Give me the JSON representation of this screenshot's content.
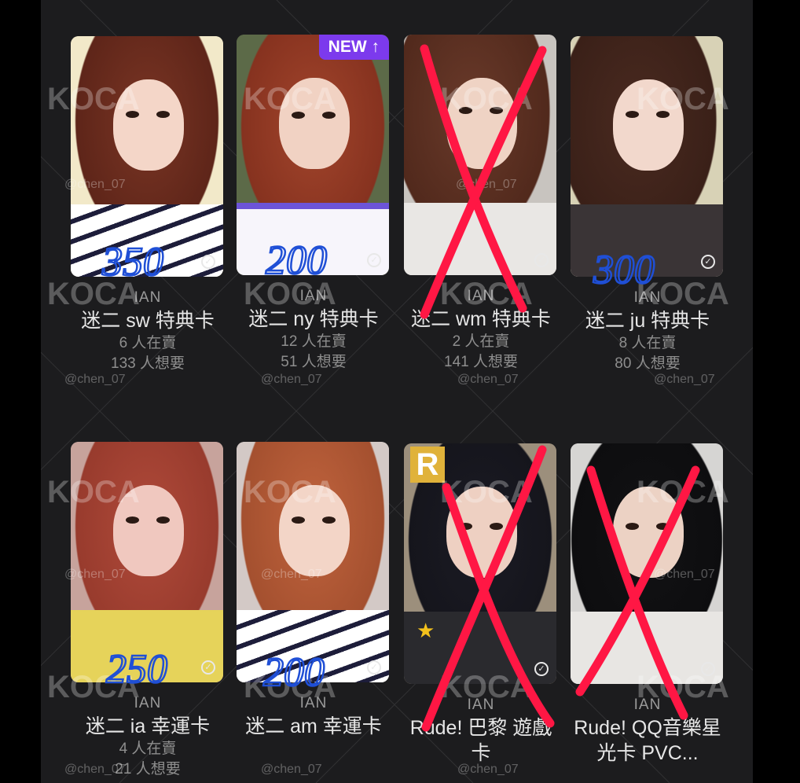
{
  "watermark": {
    "logo": "KOCA",
    "handle": "@chen_07"
  },
  "colors": {
    "panel": "#1c1c1e",
    "badge": "#7c3aed",
    "price_ink": "#1f4fd6",
    "cross_ink": "#ff1744"
  },
  "cards": [
    {
      "artist": "IAN",
      "title": "迷二 sw 特典卡",
      "selling": "6 人在賣",
      "wanting": "133 人想要",
      "price": "350",
      "crossed": false,
      "new_badge": "",
      "check_icon": "check-circle-icon"
    },
    {
      "artist": "IAN",
      "title": "迷二 ny 特典卡",
      "selling": "12 人在賣",
      "wanting": "51 人想要",
      "price": "200",
      "crossed": false,
      "new_badge": "NEW ↑",
      "check_icon": "check-circle-icon"
    },
    {
      "artist": "IAN",
      "title": "迷二 wm 特典卡",
      "selling": "2 人在賣",
      "wanting": "141 人想要",
      "price": "",
      "crossed": true,
      "new_badge": "",
      "check_icon": "check-circle-icon"
    },
    {
      "artist": "IAN",
      "title": "迷二 ju 特典卡",
      "selling": "8 人在賣",
      "wanting": "80 人想要",
      "price": "300",
      "crossed": false,
      "new_badge": "",
      "check_icon": "check-circle-icon"
    },
    {
      "artist": "IAN",
      "title": "迷二 ia 幸運卡",
      "selling": "4 人在賣",
      "wanting": "21 人想要",
      "price": "250",
      "crossed": false,
      "new_badge": "",
      "check_icon": "check-circle-icon"
    },
    {
      "artist": "IAN",
      "title": "迷二 am 幸運卡",
      "selling": "",
      "wanting": "",
      "price": "200",
      "crossed": false,
      "new_badge": "",
      "check_icon": "check-circle-icon"
    },
    {
      "artist": "IAN",
      "title": "Rude! 巴黎 遊戲卡",
      "selling": "",
      "wanting": "",
      "price": "",
      "crossed": true,
      "new_badge": "",
      "check_icon": "check-circle-icon"
    },
    {
      "artist": "IAN",
      "title": "Rude! QQ音樂星光卡 PVC...",
      "selling": "",
      "wanting": "",
      "price": "",
      "crossed": true,
      "new_badge": "",
      "check_icon": "check-circle-icon"
    }
  ]
}
